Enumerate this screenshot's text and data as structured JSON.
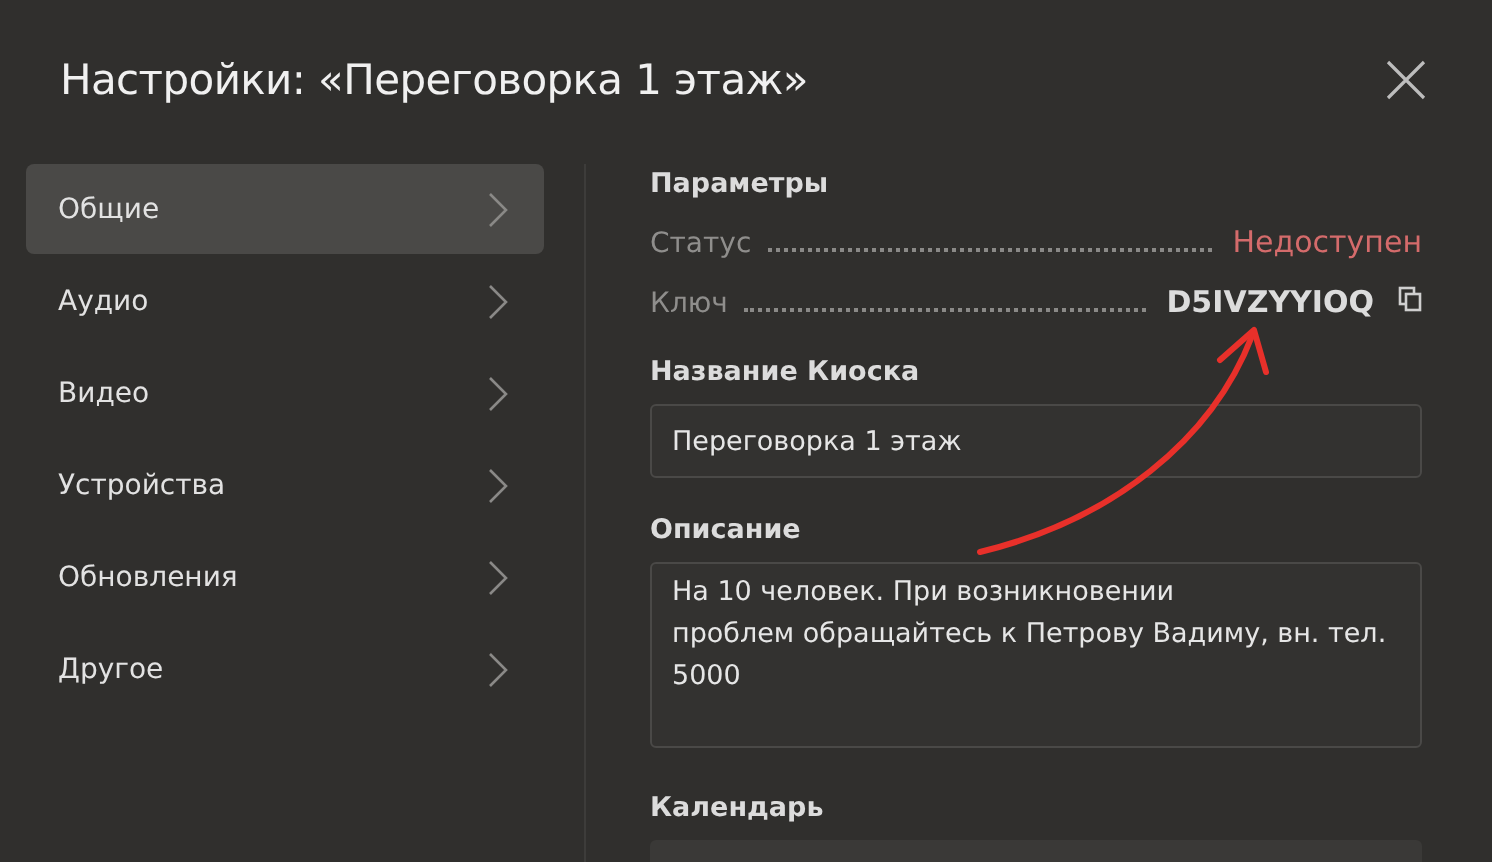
{
  "window": {
    "title": "Настройки: «Переговорка 1 этаж»"
  },
  "sidebar": {
    "items": [
      {
        "label": "Общие",
        "selected": true
      },
      {
        "label": "Аудио",
        "selected": false
      },
      {
        "label": "Видео",
        "selected": false
      },
      {
        "label": "Устройства",
        "selected": false
      },
      {
        "label": "Обновления",
        "selected": false
      },
      {
        "label": "Другое",
        "selected": false
      }
    ]
  },
  "parameters": {
    "title": "Параметры",
    "rows": [
      {
        "label": "Статус",
        "value": "Недоступен",
        "kind": "status"
      },
      {
        "label": "Ключ",
        "value": "D5IVZYYIOQ",
        "kind": "key"
      }
    ]
  },
  "fields": [
    {
      "label": "Название Киоска",
      "value": "Переговорка 1 этаж",
      "kind": "input"
    },
    {
      "label": "Описание",
      "value": "На 10 человек. При возникновении\nпроблем обращайтесь к Петрову Вадиму, вн. тел.\n5000",
      "kind": "textarea"
    },
    {
      "label": "Календарь",
      "kind": "select"
    }
  ]
}
